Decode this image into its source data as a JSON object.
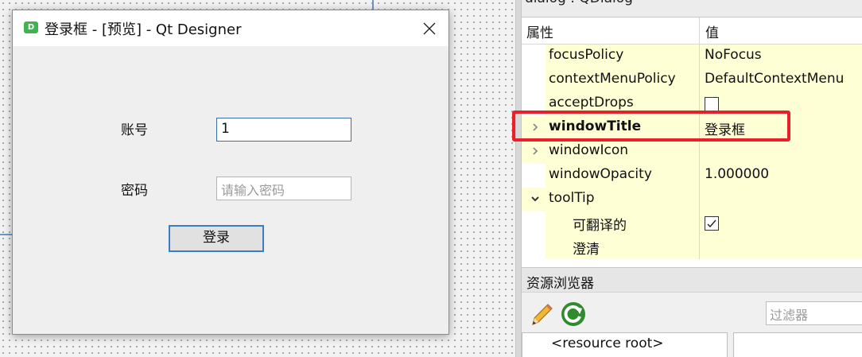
{
  "dialog": {
    "app_icon_letter": "D",
    "title": "登录框 - [预览] - Qt Designer",
    "account_label": "账号",
    "account_value": "1",
    "password_label": "密码",
    "password_placeholder": "请输入密码",
    "login_button": "登录"
  },
  "property_editor": {
    "object_header": "dialog : QDialog",
    "col_property": "属性",
    "col_value": "值",
    "rows": [
      {
        "name": "focusPolicy",
        "value": "NoFocus"
      },
      {
        "name": "contextMenuPolicy",
        "value": "DefaultContextMenu"
      },
      {
        "name": "acceptDrops",
        "value": ""
      },
      {
        "name": "windowTitle",
        "value": "登录框"
      },
      {
        "name": "windowIcon",
        "value": ""
      },
      {
        "name": "windowOpacity",
        "value": "1.000000"
      },
      {
        "name": "toolTip",
        "value": ""
      },
      {
        "name": "可翻译的",
        "value": ""
      },
      {
        "name": "澄清",
        "value": ""
      }
    ],
    "accept_drops_checked": false,
    "translatable_checked": true
  },
  "resource_browser": {
    "title": "资源浏览器",
    "filter_placeholder": "过滤器",
    "root_item": "<resource root>"
  },
  "colors": {
    "highlight": "#e8202a",
    "row_bg": "#ffffd6",
    "focus_border": "#3a6fa8",
    "button_border": "#3b7dc3"
  },
  "icons": [
    "qt-designer-app-icon",
    "close-icon",
    "chevron-right-icon",
    "chevron-down-icon",
    "checkbox-icon",
    "checkmark-icon",
    "pencil-edit-icon",
    "reload-icon"
  ]
}
